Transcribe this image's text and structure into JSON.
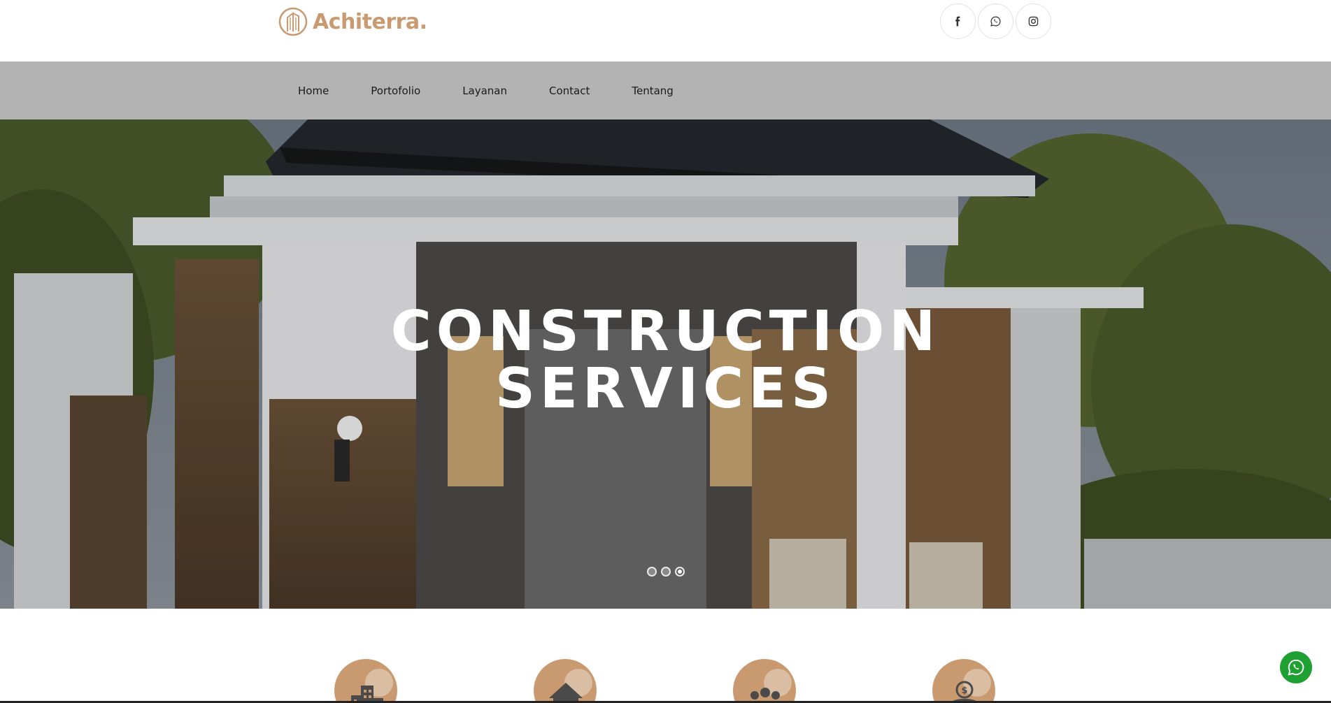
{
  "brand": {
    "name": "Achiterra.",
    "color": "#c99a70",
    "logo_icon": "building-circle-logo"
  },
  "socials": [
    {
      "name": "facebook",
      "icon": "facebook-icon"
    },
    {
      "name": "whatsapp",
      "icon": "whatsapp-icon"
    },
    {
      "name": "instagram",
      "icon": "instagram-icon"
    }
  ],
  "nav": {
    "items": [
      "Home",
      "Portofolio",
      "Layanan",
      "Contact",
      "Tentang"
    ]
  },
  "hero": {
    "line1": "CONSTRUCTION",
    "line2": "SERVICES",
    "slides_count": 3,
    "active_slide": 3
  },
  "features": {
    "icons": [
      "city-buildings-icon",
      "house-icon",
      "people-group-icon",
      "coins-dollar-icon"
    ],
    "accent": "#c99a70"
  },
  "floating_whatsapp": {
    "icon": "whatsapp-icon",
    "color": "#1ea033"
  }
}
